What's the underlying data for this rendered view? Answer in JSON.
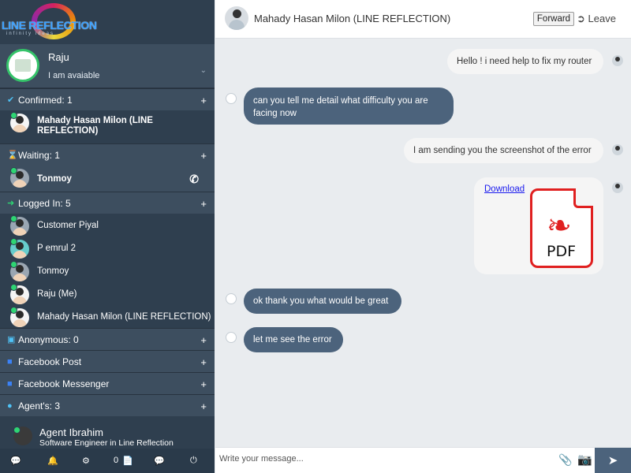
{
  "brand": {
    "logo_text": "LINE REFLECTION",
    "logo_sub": "infinity ideas"
  },
  "current_user": {
    "name": "Raju",
    "status": "I am avaiable"
  },
  "sections": {
    "confirmed": {
      "label": "Confirmed: 1",
      "items": [
        {
          "name_line1": "Mahady Hasan Milon (LINE",
          "name_line2": "REFLECTION)"
        }
      ]
    },
    "waiting": {
      "label": "Waiting: 1",
      "items": [
        {
          "name": "Tonmoy"
        }
      ]
    },
    "logged_in": {
      "label": "Logged In: 5",
      "items": [
        {
          "name": "Customer Piyal"
        },
        {
          "name": "P emrul 2"
        },
        {
          "name": "Tonmoy"
        },
        {
          "name": "Raju (Me)"
        },
        {
          "name": "Mahady Hasan Milon (LINE REFLECTION)"
        }
      ]
    },
    "anonymous": {
      "label": "Anonymous: 0"
    },
    "facebook_post": {
      "label": "Facebook Post"
    },
    "facebook_messenger": {
      "label": "Facebook Messenger"
    },
    "agents": {
      "label": "Agent's: 3"
    }
  },
  "agent": {
    "name": "Agent Ibrahim",
    "title": "Software Engineer in Line Reflection"
  },
  "footer": {
    "count": "0"
  },
  "chat": {
    "title": "Mahady Hasan Milon (LINE REFLECTION)",
    "forward_label": "Forward",
    "leave_label": "Leave",
    "messages": [
      {
        "text": "Hello ! i need help to fix my router"
      },
      {
        "text": "can you tell me detail what difficulty you are facing now"
      },
      {
        "text": "I am sending you the screenshot of the error"
      },
      {
        "text": "Download"
      },
      {
        "text": "ok thank you what would be great"
      },
      {
        "text": "let me see the error"
      }
    ],
    "pdf_label": "PDF",
    "composer_placeholder": "Write your message..."
  },
  "colors": {
    "sidebar": "#2f3f4f",
    "section": "#3d4e5f",
    "bubble_in": "#4c637c",
    "online": "#2ed573",
    "pdf_red": "#e02020"
  },
  "icons": [
    "check-circle-icon",
    "hourglass-icon",
    "login-icon",
    "lock-icon",
    "facebook-icon",
    "users-icon",
    "phone-icon",
    "chat-icon",
    "bell-icon",
    "gear-icon",
    "file-icon",
    "power-icon",
    "paperclip-icon",
    "camera-icon",
    "send-icon",
    "leave-icon",
    "pdf-icon"
  ]
}
